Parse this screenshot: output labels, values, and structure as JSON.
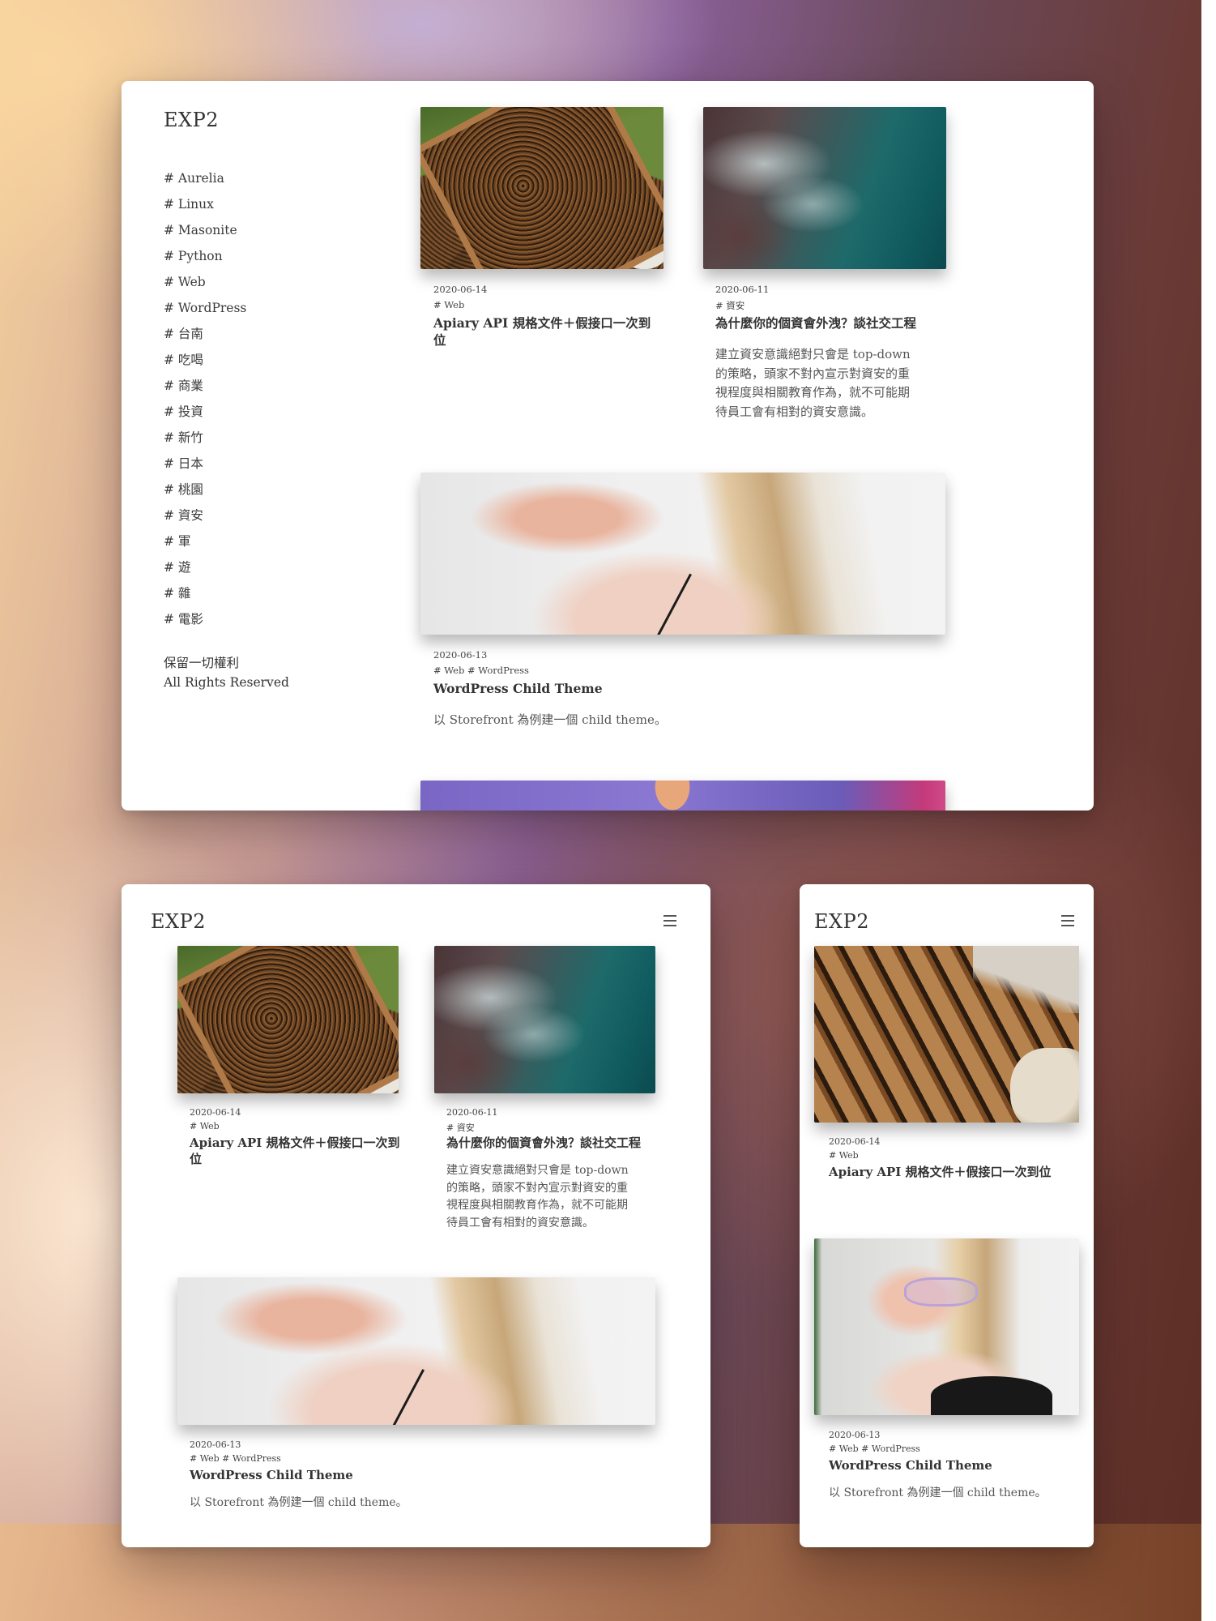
{
  "site": {
    "brand": "EXP2",
    "tags": [
      "# Aurelia",
      "# Linux",
      "# Masonite",
      "# Python",
      "# Web",
      "# WordPress",
      "# 台南",
      "# 吃喝",
      "# 商業",
      "# 投資",
      "# 新竹",
      "# 日本",
      "# 桃園",
      "# 資安",
      "# 軍",
      "# 遊",
      "# 雜",
      "# 電影"
    ],
    "footer": {
      "line1": "保留一切權利",
      "line2": "All Rights Reserved"
    },
    "menu_icon": "hamburger-icon"
  },
  "posts": [
    {
      "date": "2020-06-14",
      "tags": "# Web",
      "title": "Apiary API 規格文件＋假接口一次到位",
      "title_lines": [
        "Apiary API 規格文件＋假接口一次到",
        "位"
      ],
      "excerpt": "",
      "image": "beehive-frame"
    },
    {
      "date": "2020-06-11",
      "tags": "# 資安",
      "title": "為什麼你的個資會外洩？談社交工程",
      "excerpt_lines": [
        "建立資安意識絕對只會是 top-down",
        "的策略，頭家不對內宣示對資安的重",
        "視程度與相關教育作為，就不可能期",
        "待員工會有相對的資安意識。"
      ],
      "image": "aerial-sea"
    },
    {
      "date": "2020-06-13",
      "tags": "# Web # WordPress",
      "title": "WordPress Child Theme",
      "excerpt": "以 Storefront 為例建一個 child theme。",
      "image": "woman-portrait"
    }
  ]
}
